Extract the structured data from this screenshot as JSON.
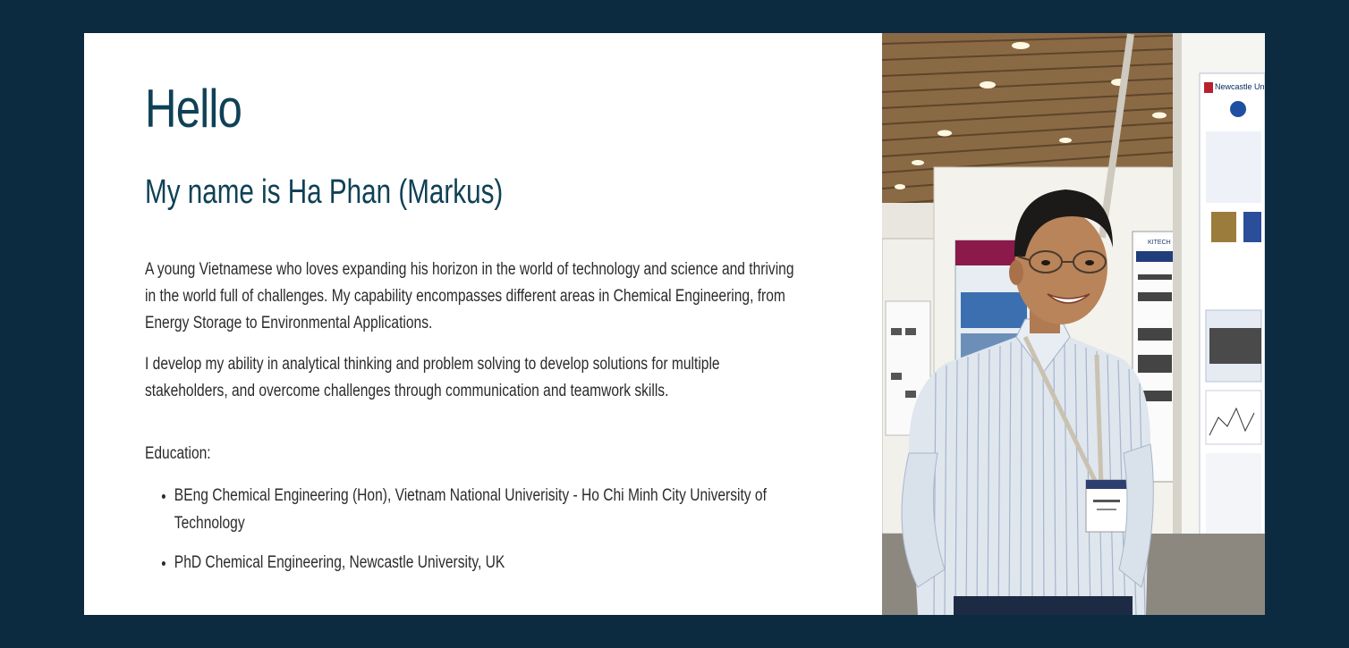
{
  "intro": {
    "greeting": "Hello",
    "name_line": "My name is Ha Phan (Markus)",
    "paragraph_1": "A young Vietnamese who loves expanding his horizon in the world of technology and science and thriving in the world full of challenges. My capability encompasses different areas in Chemical Engineering, from Energy Storage to Environmental Applications.",
    "paragraph_2": "I develop my ability in analytical thinking and problem solving to develop solutions for multiple stakeholders, and overcome challenges through communication and teamwork skills."
  },
  "education": {
    "label": "Education:",
    "items": [
      "BEng Chemical Engineering (Hon), Vietnam National Univerisity - Ho Chi Minh City University of Technology",
      "PhD Chemical Engineering, Newcastle University, UK"
    ]
  },
  "photo": {
    "poster_logo": "Newcastle University",
    "poster_logo_2": "KITECH"
  },
  "colors": {
    "page_background": "#0c2a40",
    "card_background": "#ffffff",
    "heading": "#0f4156",
    "body_text": "#2b2b2b"
  }
}
